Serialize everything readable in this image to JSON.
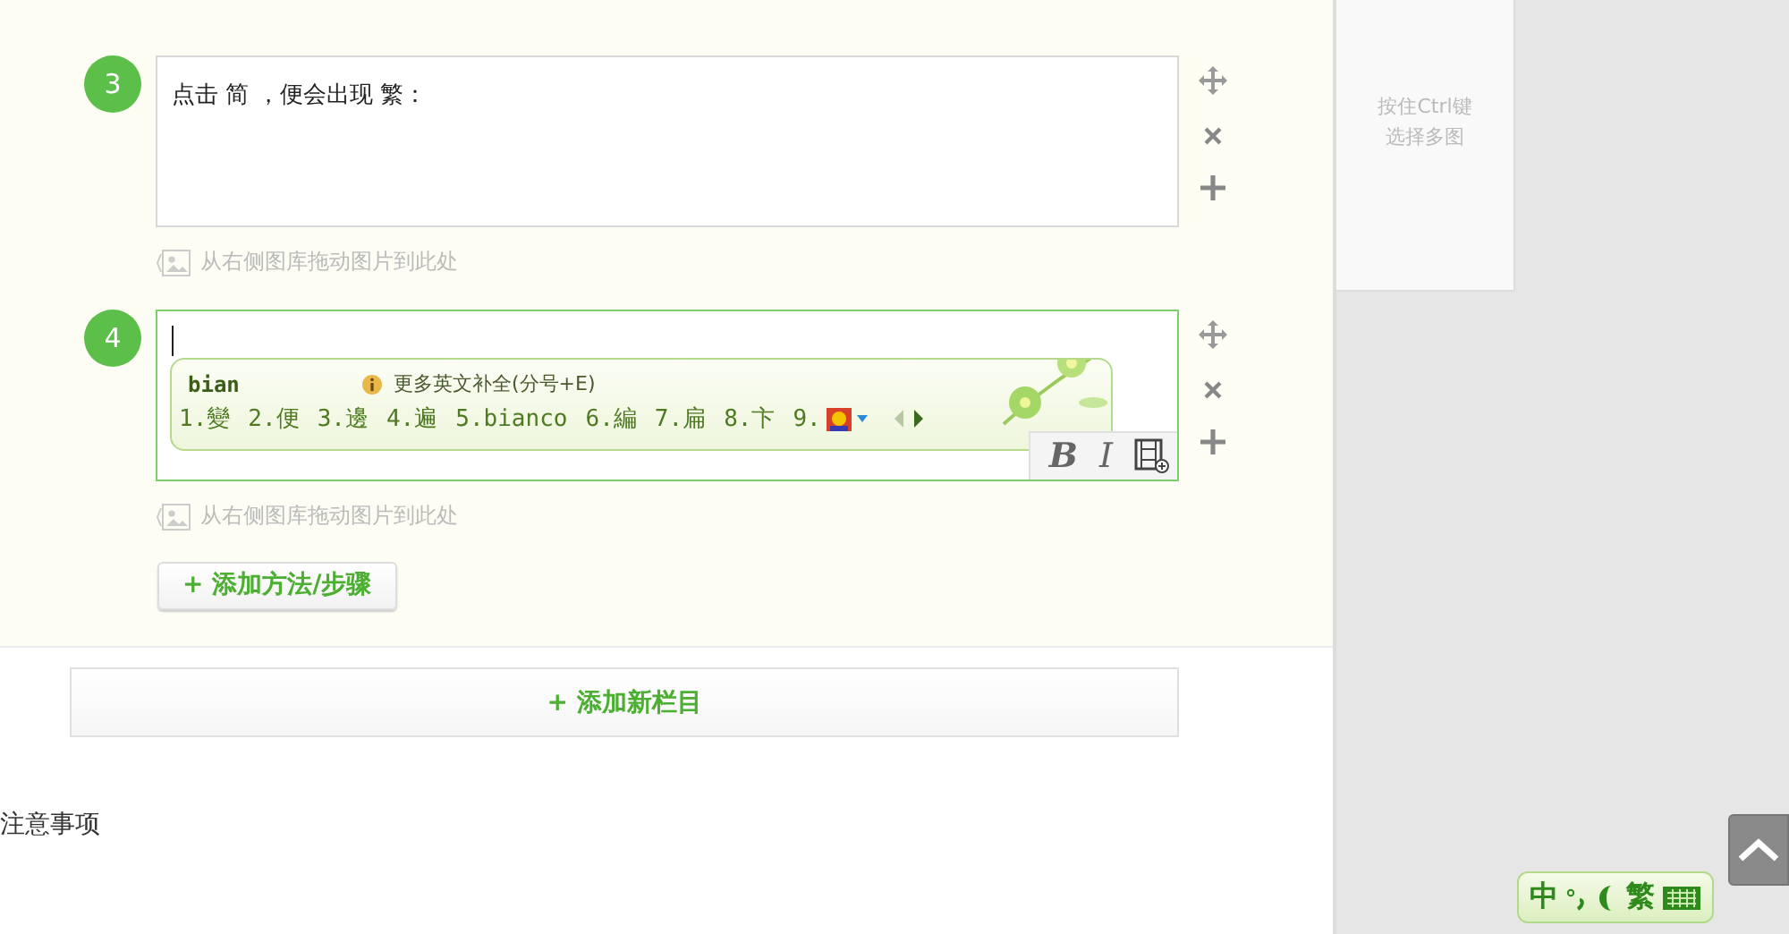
{
  "steps": [
    {
      "number": "3",
      "text": "点击 简 ，便会出现 繁：",
      "focused": false,
      "hint": "从右侧图库拖动图片到此处"
    },
    {
      "number": "4",
      "focused": true,
      "hint": "从右侧图库拖动图片到此处"
    }
  ],
  "ime_popup": {
    "input": "bian",
    "tip": "更多英文补全(分号+E)",
    "candidates": [
      "1.變",
      "2.便",
      "3.邊",
      "4.遍",
      "5.bianco",
      "6.編",
      "7.扁",
      "8.卞",
      "9."
    ]
  },
  "format_buttons": [
    "B",
    "I"
  ],
  "add_step_button": "+ 添加方法/步骤",
  "add_section_button": "+ 添加新栏目",
  "section_heading": "注意事项",
  "side_panel": {
    "hint_lines": [
      "按住Ctrl键",
      "选择多图"
    ]
  },
  "ime_status": {
    "mode": "中",
    "script": "繁"
  }
}
